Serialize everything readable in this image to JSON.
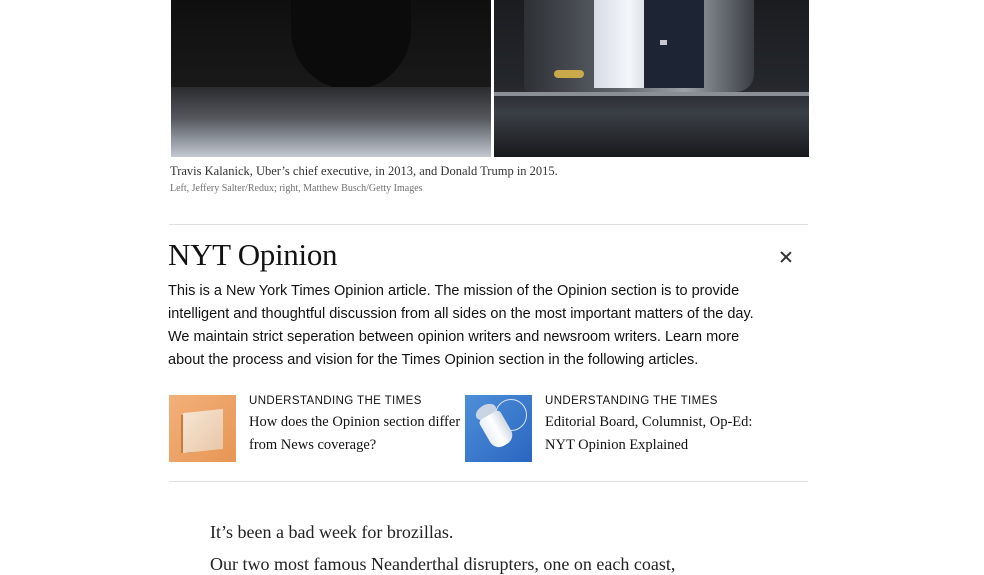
{
  "image": {
    "left_alt": "Travis Kalanick in car",
    "right_alt": "Donald Trump in car"
  },
  "caption": {
    "text": "Travis Kalanick, Uber’s chief executive, in 2013, and Donald Trump in 2015.",
    "credit": "Left, Jeffery Salter/Redux; right, Matthew Busch/Getty Images"
  },
  "opinion_box": {
    "title": "NYT Opinion",
    "description": "This is a New York Times Opinion article. The mission of the Opinion section is to provide intelligent and thoughtful discussion from all sides on the most important matters of the day. We maintain strict seperation between opinion writers and newsroom writers. Learn more about the process and vision for the Times Opinion section in the following articles.",
    "close_icon": "close-icon",
    "cards": [
      {
        "kicker": "UNDERSTANDING THE TIMES",
        "title": "How does the Opinion section differ from News coverage?",
        "thumb_color": "#e79654"
      },
      {
        "kicker": "UNDERSTANDING THE TIMES",
        "title": "Editorial Board, Columnist, Op-Ed: NYT Opinion Explained",
        "thumb_color": "#2a66c1"
      }
    ]
  },
  "article": {
    "paragraph_1": "It’s been a bad week for brozillas.",
    "paragraph_2": "Our two most famous Neanderthal disrupters, one on each coast,"
  }
}
